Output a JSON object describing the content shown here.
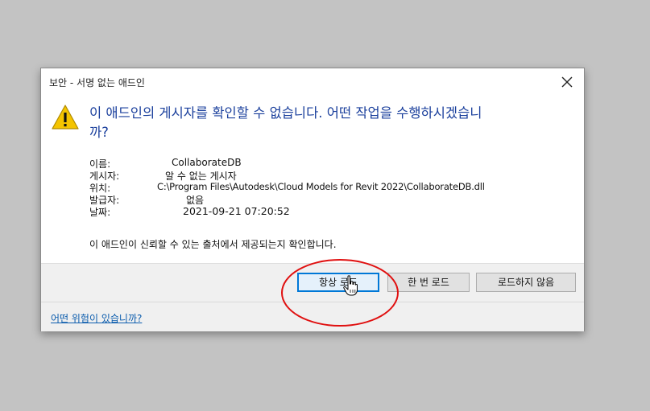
{
  "dialog": {
    "title": "보안 - 서명 없는 애드인",
    "close_icon": "close-icon",
    "warning_icon": "warning-triangle-icon",
    "headline_line1": "이 애드인의 게시자를 확인할 수 없습니다. 어떤 작업을 수행하시겠습니",
    "headline_line2": "까?",
    "info": {
      "name_label": "이름:",
      "name_value": "CollaborateDB",
      "publisher_label": "게시자:",
      "publisher_value": "알 수 없는 게시자",
      "location_label": "위치:",
      "location_value": "C:\\Program Files\\Autodesk\\Cloud Models for Revit 2022\\CollaborateDB.dll",
      "issuer_label": "발급자:",
      "issuer_value": "없음",
      "date_label": "날짜:",
      "date_value": "2021-09-21 07:20:52"
    },
    "trust_text": "이 애드인이 신뢰할 수 있는 출처에서 제공되는지 확인합니다.",
    "buttons": {
      "always_load": "항상 로드",
      "load_once": "한 번 로드",
      "do_not_load": "로드하지 않음"
    },
    "risk_link": "어떤 위험이 있습니까?"
  },
  "colors": {
    "headline": "#1a3f9c",
    "highlight_ring": "#e01010",
    "primary_button_border": "#0078d7",
    "link": "#0b5cad"
  }
}
